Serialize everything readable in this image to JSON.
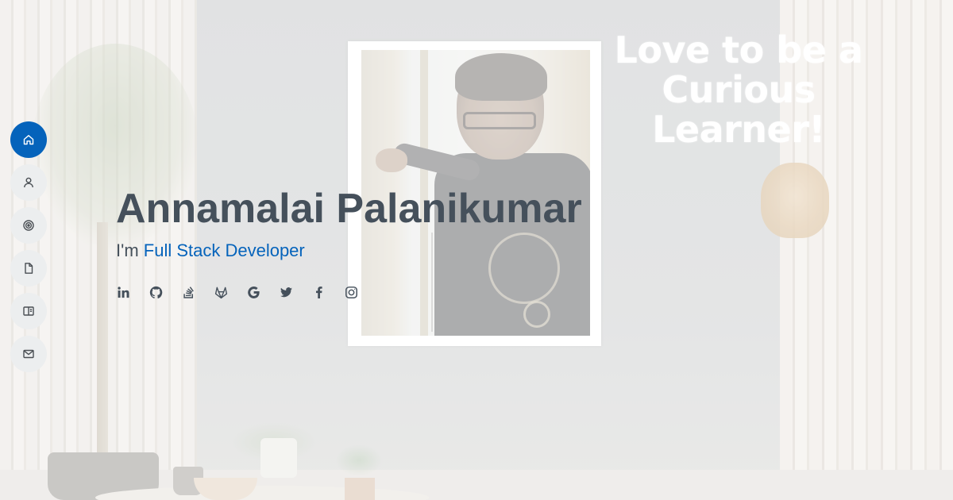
{
  "hero": {
    "name": "Annamalai Palanikumar",
    "role_prefix": "I'm ",
    "role": "Full Stack Developer"
  },
  "quote": {
    "line1": "Love to be a",
    "line2": "Curious",
    "line3": "Learner!"
  },
  "nav": {
    "items": [
      {
        "icon": "home-icon",
        "active": true
      },
      {
        "icon": "person-icon",
        "active": false
      },
      {
        "icon": "target-icon",
        "active": false
      },
      {
        "icon": "file-icon",
        "active": false
      },
      {
        "icon": "book-icon",
        "active": false
      },
      {
        "icon": "envelope-icon",
        "active": false
      }
    ]
  },
  "social": [
    {
      "icon": "linkedin-icon"
    },
    {
      "icon": "github-icon"
    },
    {
      "icon": "stackoverflow-icon"
    },
    {
      "icon": "gitlab-icon"
    },
    {
      "icon": "google-icon"
    },
    {
      "icon": "twitter-icon"
    },
    {
      "icon": "facebook-icon"
    },
    {
      "icon": "instagram-icon"
    }
  ],
  "colors": {
    "accent": "#0563bb",
    "text": "#45505b"
  }
}
